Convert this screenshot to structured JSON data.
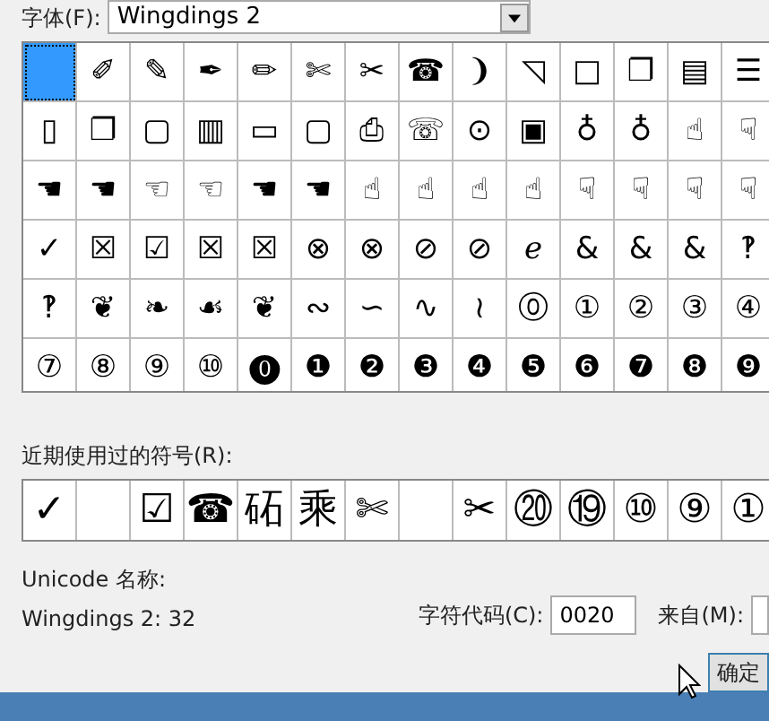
{
  "font_field": {
    "label": "字体(F):",
    "value": "Wingdings 2"
  },
  "symbol_grid": [
    [
      {
        "selected": true
      },
      {
        "symbol": "✐",
        "selected": false
      },
      {
        "symbol": "✎",
        "selected": false
      },
      {
        "symbol": "✒",
        "selected": false
      },
      {
        "symbol": "✏",
        "selected": false
      },
      {
        "symbol": "✄",
        "selected": false
      },
      {
        "symbol": "✂",
        "selected": false
      },
      {
        "symbol": "☎",
        "selected": false
      },
      {
        "symbol": "❩",
        "selected": false
      },
      {
        "symbol": "◹",
        "selected": false
      },
      {
        "symbol": "□",
        "selected": false
      },
      {
        "symbol": "❐",
        "selected": false
      },
      {
        "symbol": "▤",
        "selected": false
      },
      {
        "symbol": "☰",
        "selected": false
      }
    ],
    [
      {
        "symbol": "▯",
        "selected": false
      },
      {
        "symbol": "❐",
        "selected": false
      },
      {
        "symbol": "▢",
        "selected": false
      },
      {
        "symbol": "▥",
        "selected": false
      },
      {
        "symbol": "▭",
        "selected": false
      },
      {
        "symbol": "▢",
        "selected": false
      },
      {
        "symbol": "⎙",
        "selected": false
      },
      {
        "symbol": "☏",
        "selected": false
      },
      {
        "symbol": "⊙",
        "selected": false
      },
      {
        "symbol": "▣",
        "selected": false
      },
      {
        "symbol": "♁",
        "selected": false
      },
      {
        "symbol": "♁",
        "selected": false
      },
      {
        "symbol": "☝",
        "selected": false
      },
      {
        "symbol": "☟",
        "selected": false
      }
    ],
    [
      {
        "symbol": "☚",
        "selected": false
      },
      {
        "symbol": "☚",
        "selected": false
      },
      {
        "symbol": "☜",
        "selected": false
      },
      {
        "symbol": "☜",
        "selected": false
      },
      {
        "symbol": "☚",
        "selected": false
      },
      {
        "symbol": "☚",
        "selected": false
      },
      {
        "symbol": "☝",
        "selected": false
      },
      {
        "symbol": "☝",
        "selected": false
      },
      {
        "symbol": "☝",
        "selected": false
      },
      {
        "symbol": "☝",
        "selected": false
      },
      {
        "symbol": "☟",
        "selected": false
      },
      {
        "symbol": "☟",
        "selected": false
      },
      {
        "symbol": "☟",
        "selected": false
      },
      {
        "symbol": "☟",
        "selected": false
      }
    ],
    [
      {
        "symbol": "✓",
        "selected": false
      },
      {
        "symbol": "☒",
        "selected": false
      },
      {
        "symbol": "☑",
        "selected": false
      },
      {
        "symbol": "☒",
        "selected": false
      },
      {
        "symbol": "☒",
        "selected": false
      },
      {
        "symbol": "⊗",
        "selected": false
      },
      {
        "symbol": "⊗",
        "selected": false
      },
      {
        "symbol": "⊘",
        "selected": false
      },
      {
        "symbol": "⊘",
        "selected": false
      },
      {
        "symbol": "ℯ",
        "selected": false
      },
      {
        "symbol": "&",
        "selected": false
      },
      {
        "symbol": "&",
        "selected": false
      },
      {
        "symbol": "&",
        "selected": false
      },
      {
        "symbol": "‽",
        "selected": false
      }
    ],
    [
      {
        "symbol": "‽",
        "selected": false
      },
      {
        "symbol": "❦",
        "selected": false
      },
      {
        "symbol": "❧",
        "selected": false
      },
      {
        "symbol": "☙",
        "selected": false
      },
      {
        "symbol": "❦",
        "selected": false
      },
      {
        "symbol": "∾",
        "selected": false
      },
      {
        "symbol": "∽",
        "selected": false
      },
      {
        "symbol": "∿",
        "selected": false
      },
      {
        "symbol": "≀",
        "selected": false
      },
      {
        "symbol": "⓪",
        "selected": false
      },
      {
        "symbol": "①",
        "selected": false
      },
      {
        "symbol": "②",
        "selected": false
      },
      {
        "symbol": "③",
        "selected": false
      },
      {
        "symbol": "④",
        "selected": false
      }
    ],
    [
      {
        "symbol": "⑦",
        "selected": false
      },
      {
        "symbol": "⑧",
        "selected": false
      },
      {
        "symbol": "⑨",
        "selected": false
      },
      {
        "symbol": "⑩",
        "selected": false
      },
      {
        "symbol": "⓿",
        "selected": false
      },
      {
        "symbol": "❶",
        "selected": false
      },
      {
        "symbol": "❷",
        "selected": false
      },
      {
        "symbol": "❸",
        "selected": false
      },
      {
        "symbol": "❹",
        "selected": false
      },
      {
        "symbol": "❺",
        "selected": false
      },
      {
        "symbol": "❻",
        "selected": false
      },
      {
        "symbol": "❼",
        "selected": false
      },
      {
        "symbol": "❽",
        "selected": false
      },
      {
        "symbol": "❾",
        "selected": false
      }
    ]
  ],
  "recent_symbols": {
    "label": "近期使用过的符号(R):",
    "items": [
      {
        "kind": "symbol",
        "symbol": "✓"
      },
      {
        "kind": "blank"
      },
      {
        "kind": "symbol",
        "symbol": "☑"
      },
      {
        "kind": "symbol",
        "symbol": "☎"
      },
      {
        "kind": "symbol",
        "symbol": "砳"
      },
      {
        "kind": "symbol",
        "symbol": "乘"
      },
      {
        "kind": "symbol",
        "symbol": "✄"
      },
      {
        "kind": "blank"
      },
      {
        "kind": "symbol",
        "symbol": "✂"
      },
      {
        "kind": "symbol",
        "symbol": "⑳"
      },
      {
        "kind": "symbol",
        "symbol": "⑲"
      },
      {
        "kind": "symbol",
        "symbol": "⑩"
      },
      {
        "kind": "symbol",
        "symbol": "⑨"
      },
      {
        "kind": "symbol",
        "symbol": "①"
      }
    ]
  },
  "unicode_name_label": "Unicode 名称:",
  "symbol_name": "Wingdings 2: 32",
  "char_code": {
    "label": "字符代码(C):",
    "value": "0020"
  },
  "from_label": "来自(M):",
  "ok_button": "确定"
}
